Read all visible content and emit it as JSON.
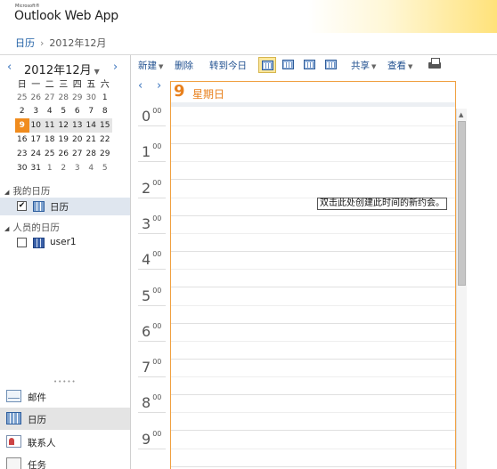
{
  "header": {
    "ms_label": "Microsoft®",
    "app_title": "Outlook Web App"
  },
  "breadcrumb": {
    "root": "日历",
    "current": "2012年12月"
  },
  "mini_calendar": {
    "prev": "‹",
    "next": "›",
    "month_title": "2012年12月",
    "weekdays": [
      "日",
      "一",
      "二",
      "三",
      "四",
      "五",
      "六"
    ],
    "weeks": [
      [
        "25",
        "26",
        "27",
        "28",
        "29",
        "30",
        "1"
      ],
      [
        "2",
        "3",
        "4",
        "5",
        "6",
        "7",
        "8"
      ],
      [
        "9",
        "10",
        "11",
        "12",
        "13",
        "14",
        "15"
      ],
      [
        "16",
        "17",
        "18",
        "19",
        "20",
        "21",
        "22"
      ],
      [
        "23",
        "24",
        "25",
        "26",
        "27",
        "28",
        "29"
      ],
      [
        "30",
        "31",
        "1",
        "2",
        "3",
        "4",
        "5"
      ]
    ]
  },
  "groups": {
    "mine": {
      "label": "我的日历",
      "item": "日历",
      "checked": "✔"
    },
    "people": {
      "label": "人员的日历",
      "item": "user1"
    }
  },
  "dots": "•••••",
  "nav": {
    "mail": "邮件",
    "calendar": "日历",
    "contacts": "联系人",
    "tasks": "任务"
  },
  "toolbar": {
    "new": "新建",
    "delete": "删除",
    "today": "转到今日",
    "share": "共享",
    "view": "查看"
  },
  "day_nav": {
    "prev": "‹",
    "next": "›"
  },
  "day": {
    "number": "9",
    "name": "星期日"
  },
  "hours": [
    "0",
    "1",
    "2",
    "3",
    "4",
    "5",
    "6",
    "7",
    "8",
    "9"
  ],
  "minutes": "00",
  "hint": "双击此处创建此时间的新约会。"
}
